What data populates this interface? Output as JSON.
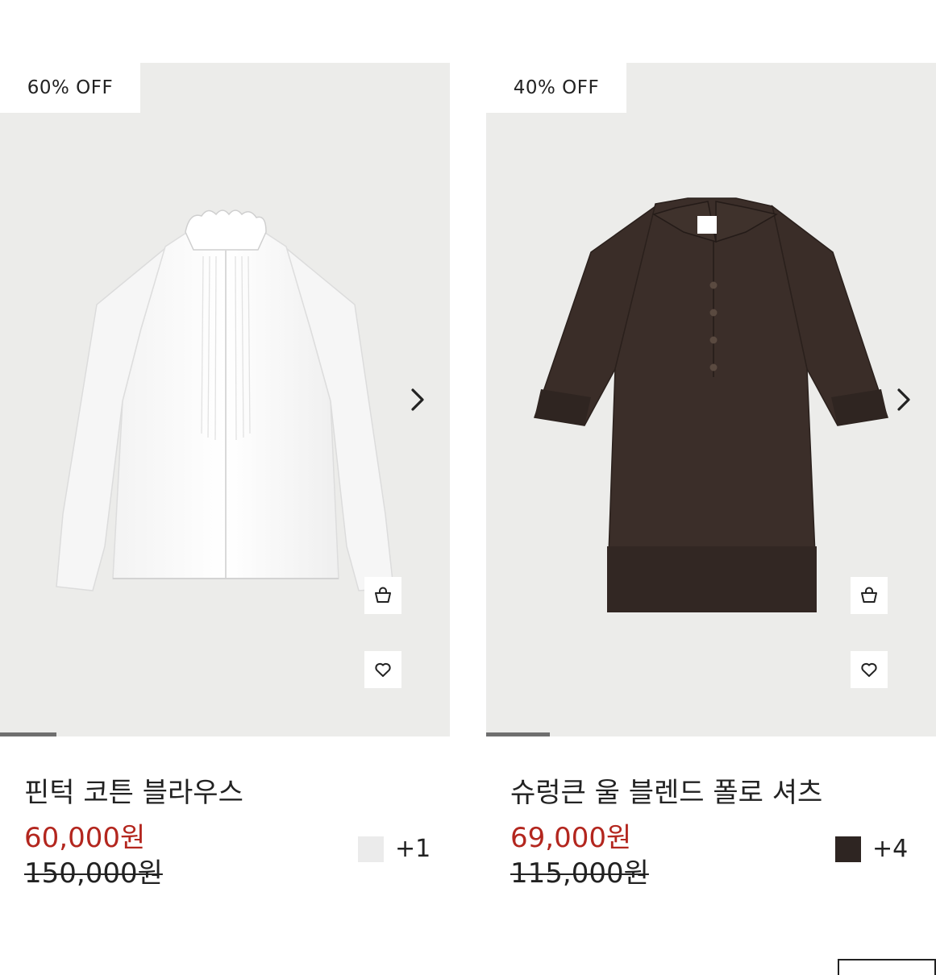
{
  "products": [
    {
      "badge": "60% OFF",
      "name": "핀턱 코튼 블라우스",
      "sale_price": "60,000원",
      "original_price": "150,000원",
      "swatch_color": "#ebebeb",
      "swatch_count": "+1",
      "image_icon": "white-blouse-image",
      "image_progress": 0.125
    },
    {
      "badge": "40% OFF",
      "name": "슈렁큰 울 블렌드 폴로 셔츠",
      "sale_price": "69,000원",
      "original_price": "115,000원",
      "swatch_color": "#2e2522",
      "swatch_count": "+4",
      "image_icon": "brown-polo-shirt-image",
      "image_progress": 0.142
    }
  ],
  "colors": {
    "sale_red": "#b3261e",
    "image_background": "#ececea",
    "text": "#222222"
  }
}
